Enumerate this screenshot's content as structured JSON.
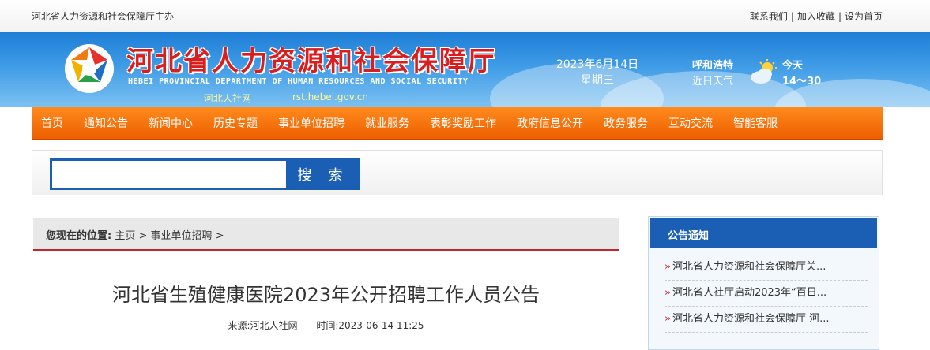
{
  "topbar": {
    "sponsor": "河北省人力资源和社会保障厅主办",
    "links": [
      "联系我们",
      "加入收藏",
      "设为首页"
    ]
  },
  "header": {
    "title": "河北省人力资源和社会保障厅",
    "title_en": "HEBEI PROVINCIAL DEPARTMENT OF HUMAN RESOURCES AND SOCIAL SECURITY",
    "short_name": "河北人社网",
    "url": "rst.hebei.gov.cn",
    "date": "2023年6月14日",
    "weekday": "星期三",
    "city": "呼和浩特",
    "forecast_label": "近日天气",
    "weather_day": "今天",
    "temperature": "14～30",
    "weather_icon": "partly-cloudy-icon"
  },
  "nav": {
    "items": [
      "首页",
      "通知公告",
      "新闻中心",
      "历史专题",
      "事业单位招聘",
      "就业服务",
      "表彰奖励工作",
      "政府信息公开",
      "政务服务",
      "互动交流",
      "智能客服"
    ]
  },
  "search": {
    "value": "",
    "button_label": "搜 索"
  },
  "breadcrumb": {
    "label": "您现在的位置:",
    "items": [
      "主页",
      "事业单位招聘"
    ],
    "separator": ">"
  },
  "article": {
    "title": "河北省生殖健康医院2023年公开招聘工作人员公告",
    "source": "来源:河北人社网",
    "time": "时间:2023-06-14 11:25"
  },
  "notice": {
    "title": "公告通知",
    "items": [
      "河北省人力资源和社会保障厅关...",
      "河北省人社厅启动2023年“百日...",
      "河北省人力资源和社会保障厅 河..."
    ]
  },
  "colors": {
    "nav_orange": "#ee5f00",
    "brand_blue": "#1a5fb4",
    "title_red": "#d81e1e"
  }
}
